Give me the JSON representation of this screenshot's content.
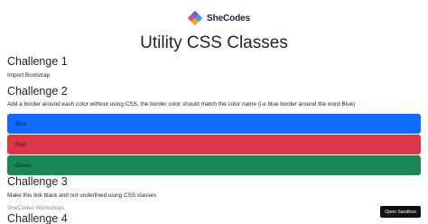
{
  "brand": {
    "logo_text": "SheCodes",
    "logo_icon": "shecodes-logo-icon"
  },
  "page": {
    "title": "Utility CSS Classes"
  },
  "challenges": {
    "c1": {
      "heading": "Challenge 1",
      "text": "Import Bootstrap"
    },
    "c2": {
      "heading": "Challenge 2",
      "text": "Add a border around each color without using CSS, the border color should match the color name (i.e blue border around the word Blue)",
      "boxes": [
        {
          "label": "Blue",
          "color": "#0d6efd"
        },
        {
          "label": "Red",
          "color": "#dc3545"
        },
        {
          "label": "Green",
          "color": "#198754"
        }
      ]
    },
    "c3": {
      "heading": "Challenge 3",
      "text": "Make this link black and not underlined using CSS classes",
      "link_text": "SheCodes Workshops"
    },
    "c4": {
      "heading": "Challenge 4"
    }
  },
  "sandbox": {
    "button_label": "Open Sandbox"
  }
}
